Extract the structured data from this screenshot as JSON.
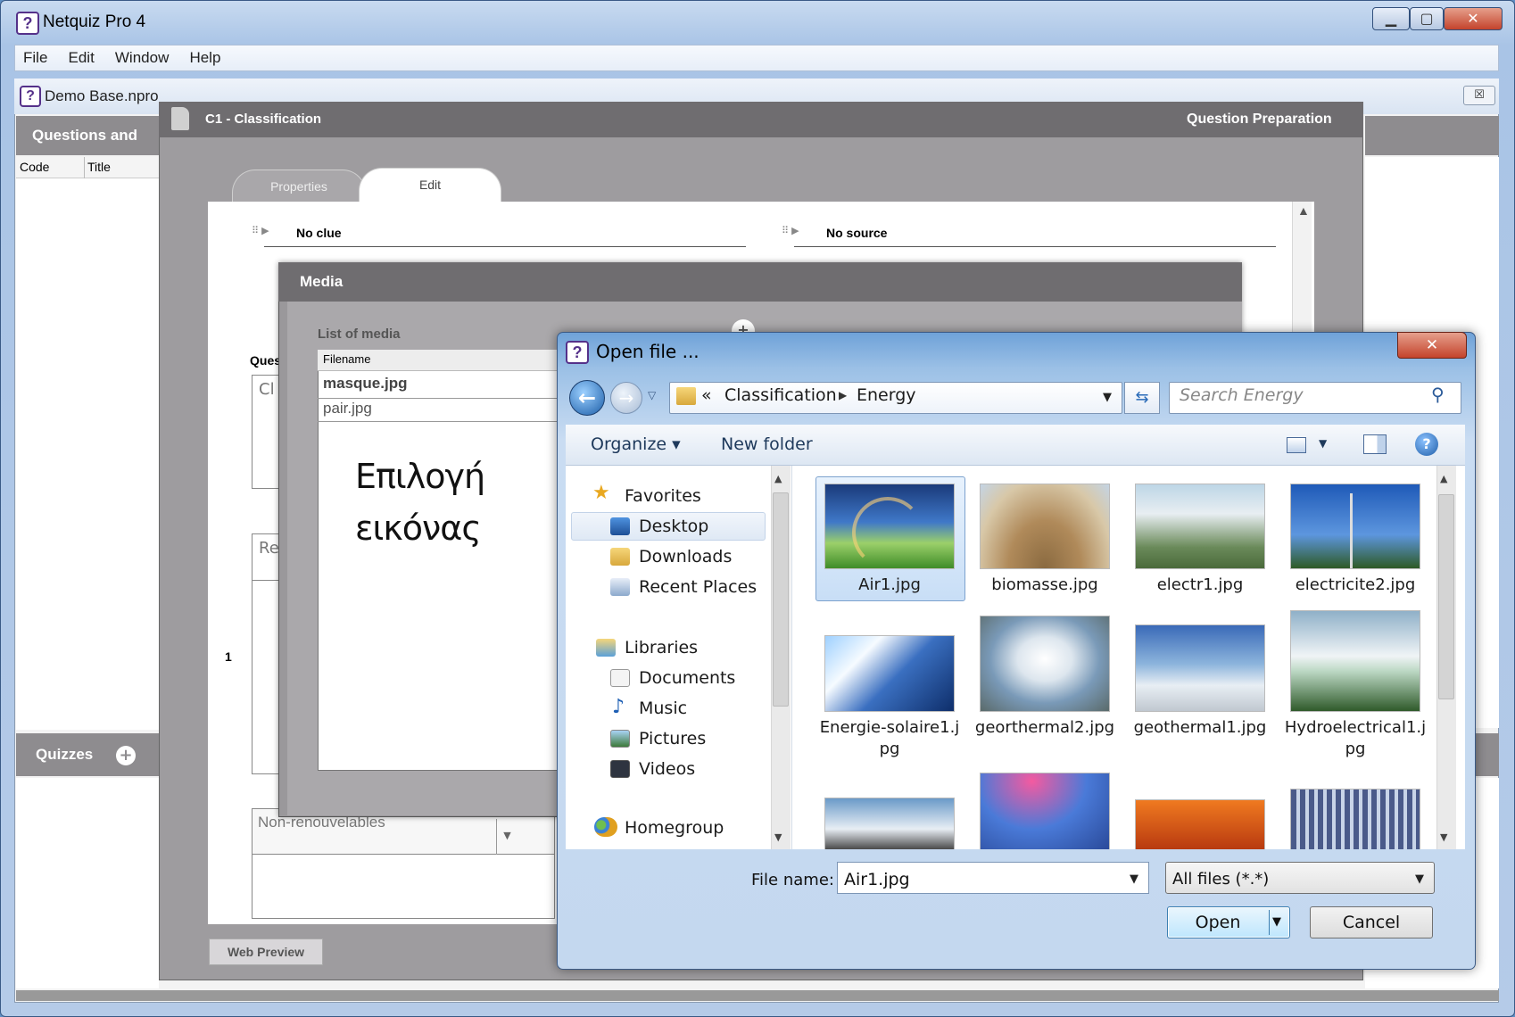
{
  "app": {
    "title": "Netquiz Pro 4",
    "menu": [
      "File",
      "Edit",
      "Window",
      "Help"
    ],
    "doc_title": "Demo Base.npro"
  },
  "left_panel": {
    "questions_header": "Questions and",
    "columns": [
      "Code",
      "Title"
    ],
    "quizzes_header": "Quizzes"
  },
  "editor": {
    "title": "C1 - Classification",
    "subtitle": "Question Preparation",
    "tabs": [
      "Properties",
      "Edit"
    ],
    "clue": "No clue",
    "source": "No source",
    "ques_label": "Ques",
    "cl_text": "Cl",
    "re_text": "Re",
    "row_number": "1",
    "non_renew": "Non-renouvelables",
    "web_preview": "Web Preview"
  },
  "media": {
    "title": "Media",
    "list_label": "List of media",
    "filename_header": "Filename",
    "files": [
      "masque.jpg",
      "pair.jpg"
    ]
  },
  "annotation": {
    "line1": "Επιλογή",
    "line2": "εικόνας"
  },
  "dialog": {
    "title": "Open file ...",
    "breadcrumb": {
      "prefix": "«",
      "parts": [
        "Classification",
        "Energy"
      ]
    },
    "search_placeholder": "Search Energy",
    "organize": "Organize ▾",
    "new_folder": "New folder",
    "nav": {
      "favorites": "Favorites",
      "desktop": "Desktop",
      "downloads": "Downloads",
      "recent": "Recent Places",
      "libraries": "Libraries",
      "documents": "Documents",
      "music": "Music",
      "pictures": "Pictures",
      "videos": "Videos",
      "homegroup": "Homegroup"
    },
    "files": [
      "Air1.jpg",
      "biomasse.jpg",
      "electr1.jpg",
      "electricite2.jpg",
      "Energie-solaire1.j pg",
      "georthermal2.jpg",
      "geothermal1.jpg",
      "Hydroelectrical1.j pg"
    ],
    "filename_label": "File name:",
    "filename_value": "Air1.jpg",
    "filter": "All files (*.*)",
    "open": "Open",
    "cancel": "Cancel"
  }
}
